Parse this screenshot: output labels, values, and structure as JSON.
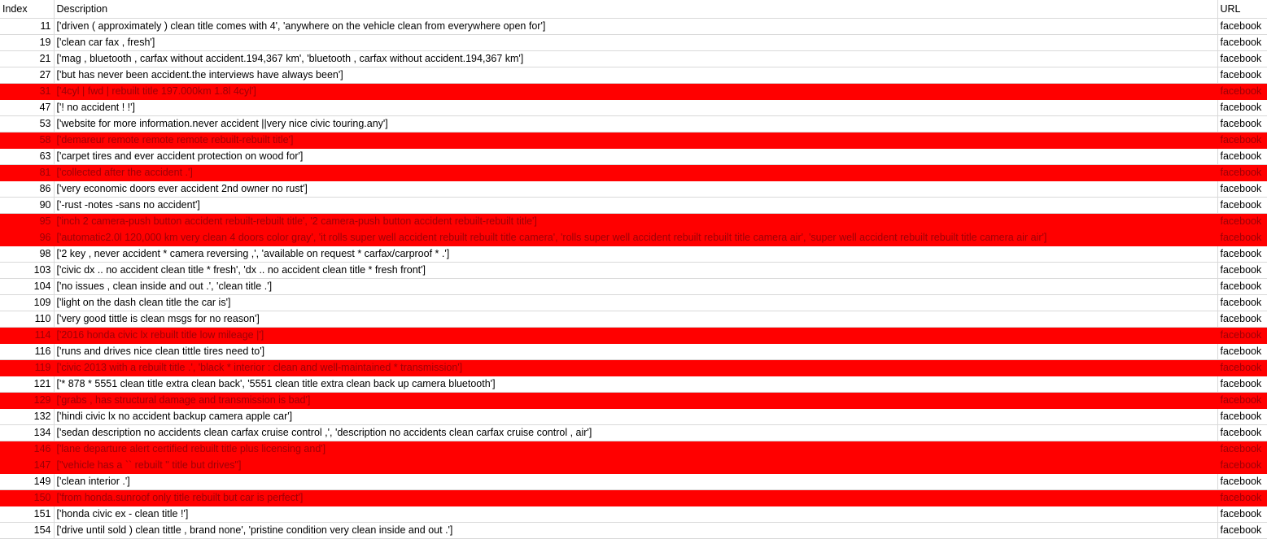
{
  "header": {
    "index": "Index",
    "description": "Description",
    "url": "URL"
  },
  "highlight_color": "#ff0000",
  "rows": [
    {
      "index": "11",
      "description": "['driven ( approximately ) clean title comes with 4', 'anywhere on the vehicle clean from everywhere open for']",
      "url": "facebook",
      "highlighted": false
    },
    {
      "index": "19",
      "description": "['clean car fax , fresh']",
      "url": "facebook",
      "highlighted": false
    },
    {
      "index": "21",
      "description": "['mag , bluetooth , carfax without accident.194,367 km', 'bluetooth , carfax without accident.194,367 km']",
      "url": "facebook",
      "highlighted": false
    },
    {
      "index": "27",
      "description": "['but has never been accident.the interviews have always been']",
      "url": "facebook",
      "highlighted": false
    },
    {
      "index": "31",
      "description": "['4cyl | fwd | rebuilt title 197.000km 1.8l 4cyl']",
      "url": "facebook",
      "highlighted": true
    },
    {
      "index": "47",
      "description": "['! no accident ! !']",
      "url": "facebook",
      "highlighted": false
    },
    {
      "index": "53",
      "description": "['website for more information.never accident ||very nice civic touring.any']",
      "url": "facebook",
      "highlighted": false
    },
    {
      "index": "58",
      "description": "['demareur remote remote remote rebuilt-rebuilt title']",
      "url": "facebook",
      "highlighted": true
    },
    {
      "index": "63",
      "description": "['carpet tires and ever accident protection on wood for']",
      "url": "facebook",
      "highlighted": false
    },
    {
      "index": "81",
      "description": "['collected after the accident .']",
      "url": "facebook",
      "highlighted": true
    },
    {
      "index": "86",
      "description": "['very economic doors ever accident 2nd owner no rust']",
      "url": "facebook",
      "highlighted": false
    },
    {
      "index": "90",
      "description": "['-rust -notes -sans no accident']",
      "url": "facebook",
      "highlighted": false
    },
    {
      "index": "95",
      "description": "['inch 2 camera-push button accident rebuilt-rebuilt title', '2 camera-push button accident rebuilt-rebuilt title']",
      "url": "facebook",
      "highlighted": true
    },
    {
      "index": "96",
      "description": "['automatic2.0l 120,000 km very clean 4 doors color gray', 'it rolls super well accident rebuilt rebuilt title camera', 'rolls super well accident rebuilt rebuilt title camera air', 'super well accident rebuilt rebuilt title camera air air']",
      "url": "facebook",
      "highlighted": true
    },
    {
      "index": "98",
      "description": "['2 key , never accident * camera reversing ,', 'available on request * carfax/carproof * .']",
      "url": "facebook",
      "highlighted": false
    },
    {
      "index": "103",
      "description": "['civic dx .. no accident clean title * fresh', 'dx .. no accident clean title * fresh front']",
      "url": "facebook",
      "highlighted": false
    },
    {
      "index": "104",
      "description": "['no issues , clean inside and out .', 'clean title .']",
      "url": "facebook",
      "highlighted": false
    },
    {
      "index": "109",
      "description": "['light on the dash clean title the car is']",
      "url": "facebook",
      "highlighted": false
    },
    {
      "index": "110",
      "description": "['very good tittle is clean msgs for no reason']",
      "url": "facebook",
      "highlighted": false
    },
    {
      "index": "114",
      "description": "['2016 honda civic lx rebuilt title low mileage |']",
      "url": "facebook",
      "highlighted": true
    },
    {
      "index": "116",
      "description": "['runs and drives nice clean tittle tires need to']",
      "url": "facebook",
      "highlighted": false
    },
    {
      "index": "119",
      "description": "['civic 2013 with a rebuilt title .', 'black * interior : clean and well-maintained * transmission']",
      "url": "facebook",
      "highlighted": true
    },
    {
      "index": "121",
      "description": "['* 878 * 5551 clean title extra clean back', '5551 clean title extra clean back up camera bluetooth']",
      "url": "facebook",
      "highlighted": false
    },
    {
      "index": "129",
      "description": "['grabs , has structural damage and transmission is bad']",
      "url": "facebook",
      "highlighted": true
    },
    {
      "index": "132",
      "description": "['hindi civic lx no accident backup camera apple car']",
      "url": "facebook",
      "highlighted": false
    },
    {
      "index": "134",
      "description": "['sedan description no accidents clean carfax cruise control ,', 'description no accidents clean carfax cruise control , air']",
      "url": "facebook",
      "highlighted": false
    },
    {
      "index": "146",
      "description": "['lane departure alert certified rebuilt title plus licensing and']",
      "url": "facebook",
      "highlighted": true
    },
    {
      "index": "147",
      "description": "[\"vehicle has a `` rebuilt '' title but drives\"]",
      "url": "facebook",
      "highlighted": true
    },
    {
      "index": "149",
      "description": "['clean interior .']",
      "url": "facebook",
      "highlighted": false
    },
    {
      "index": "150",
      "description": "['from honda.sunroof only title rebuilt but car is perfect']",
      "url": "facebook",
      "highlighted": true
    },
    {
      "index": "151",
      "description": "['honda civic ex - clean title !']",
      "url": "facebook",
      "highlighted": false
    },
    {
      "index": "154",
      "description": "['drive until sold ) clean tittle , brand none', 'pristine condition very clean inside and out .']",
      "url": "facebook",
      "highlighted": false
    }
  ]
}
